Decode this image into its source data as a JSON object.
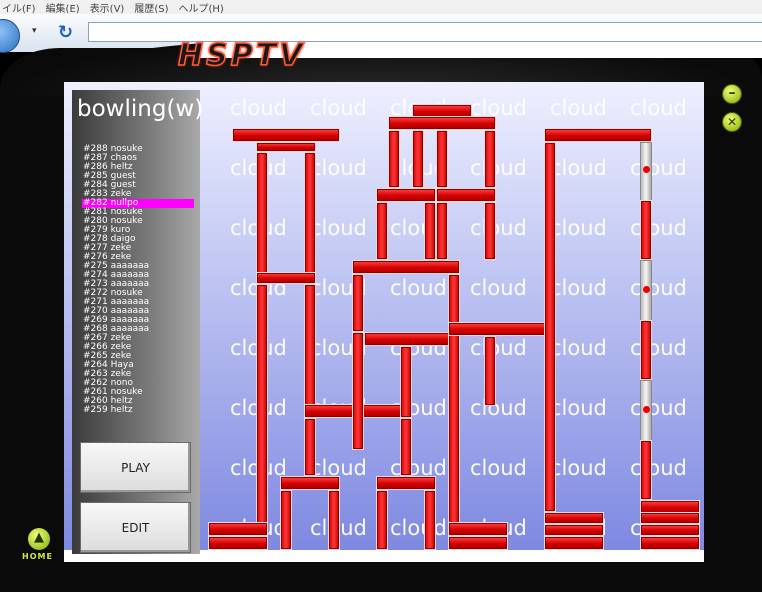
{
  "browser": {
    "menu": [
      "イル(F)",
      "編集(E)",
      "表示(V)",
      "履歴(S)",
      "ヘルプ(H)"
    ],
    "dropdown_glyph": "▾",
    "refresh_glyph": "↻"
  },
  "app": {
    "logo": "HSPTV",
    "home_label": "HOME",
    "min_glyph": "–",
    "close_glyph": "✕",
    "home_glyph": "▲"
  },
  "game": {
    "level_title": "bowling(w)",
    "background_word": "cloud",
    "selected_index": 6,
    "records": [
      "#288 nosuke",
      "#287 chaos",
      "#286 heltz",
      "#285 guest",
      "#284 guest",
      "#283 zeke",
      "#282 nullpo",
      "#281 nosuke",
      "#280 nosuke",
      "#279 kuro",
      "#278 daigo",
      "#277 zeke",
      "#276 zeke",
      "#275 aaaaaaa",
      "#274 aaaaaaa",
      "#273 aaaaaaa",
      "#272 nosuke",
      "#271 aaaaaaa",
      "#270 aaaaaaa",
      "#269 aaaaaaa",
      "#268 aaaaaaa",
      "#267 zeke",
      "#266 zeke",
      "#265 zeke",
      "#264 Haya",
      "#263 zeke",
      "#262 nono",
      "#261 nosuke",
      "#260 heltz",
      "#259 heltz"
    ],
    "play_label": "PLAY",
    "edit_label": "EDIT"
  },
  "colors": {
    "block_red": "#e00000",
    "selected_row": "#ff00ff",
    "accent_green": "#9ccc00"
  }
}
